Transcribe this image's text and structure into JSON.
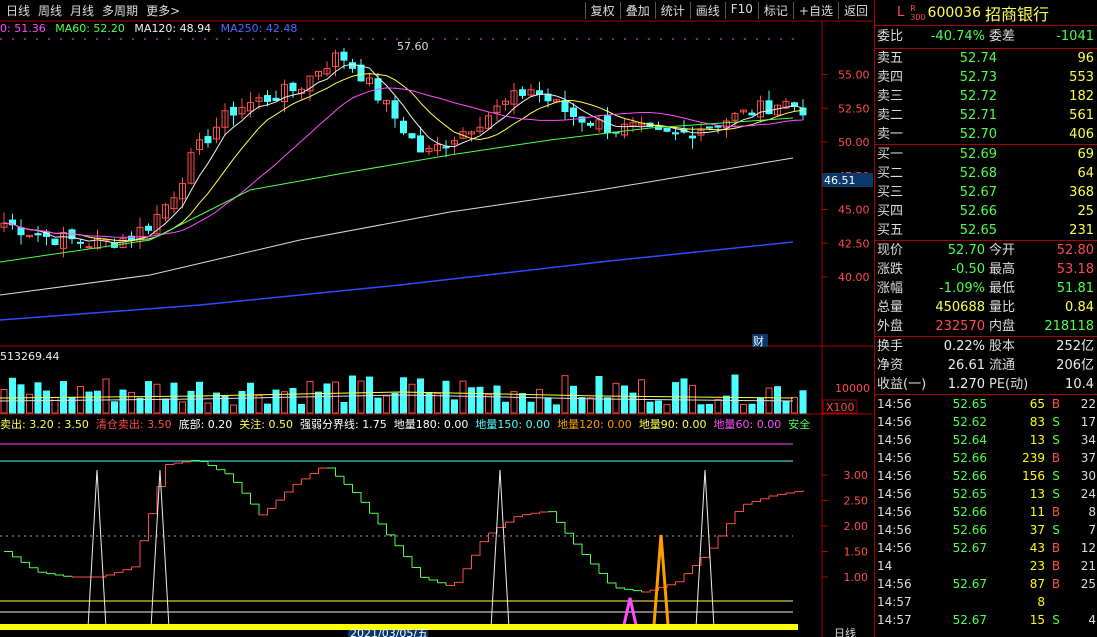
{
  "toolbar": {
    "tabs": [
      "日线",
      "周线",
      "月线",
      "多周期",
      "更多>"
    ],
    "buttons": [
      "复权",
      "叠加",
      "统计",
      "画线",
      "F10",
      "标记",
      "+自选",
      "返回"
    ]
  },
  "ma_legend": [
    {
      "text": "0: 51.36",
      "color": "#ff4cff"
    },
    {
      "text": "MA60: 52.20",
      "color": "#4cff4c"
    },
    {
      "text": "MA120: 48.94",
      "color": "#eeeeee"
    },
    {
      "text": "MA250: 42.48",
      "color": "#4c6cff"
    }
  ],
  "price_axis": [
    "55.00",
    "52.50",
    "50.00",
    "47.50",
    "45.00",
    "42.50",
    "40.00"
  ],
  "current_price_tag": "46.51",
  "high_marker": "57.60",
  "cai_label": "财",
  "volume": {
    "legend": "513269.44",
    "axis": "10000",
    "unit": "X100"
  },
  "indicator": {
    "items": [
      {
        "text": "卖出: 3.20 : 3.50",
        "color": "#ffff4c"
      },
      {
        "text": "清仓卖出: 3.50",
        "color": "#ff4c4c"
      },
      {
        "text": "底部: 0.20",
        "color": "#ffffff"
      },
      {
        "text": "关注: 0.50",
        "color": "#ffff4c"
      },
      {
        "text": "强弱分界线: 1.75",
        "color": "#ffffff"
      },
      {
        "text": "地量180: 0.00",
        "color": "#ffffff"
      },
      {
        "text": "地量150: 0.00",
        "color": "#4cffff"
      },
      {
        "text": "地量120: 0.00",
        "color": "#ff9c00"
      },
      {
        "text": "地量90: 0.00",
        "color": "#ffff4c"
      },
      {
        "text": "地量60: 0.00",
        "color": "#ff4cff"
      },
      {
        "text": "安全",
        "color": "#4cff4c"
      }
    ],
    "axis": [
      "3.00",
      "2.50",
      "2.00",
      "1.50",
      "1.00"
    ]
  },
  "date_label": "2021/03/05/五",
  "period_label": "日线",
  "quote": {
    "market_tag": "L",
    "r_tag": "R",
    "code_sub": "300",
    "code": "600036",
    "name": "招商银行",
    "weibi": {
      "label": "委比",
      "value": "-40.74%"
    },
    "weicha": {
      "label": "委差",
      "value": "-1041"
    },
    "sells": [
      {
        "label": "卖五",
        "price": "52.74",
        "qty": "96"
      },
      {
        "label": "卖四",
        "price": "52.73",
        "qty": "553"
      },
      {
        "label": "卖三",
        "price": "52.72",
        "qty": "182"
      },
      {
        "label": "卖二",
        "price": "52.71",
        "qty": "561"
      },
      {
        "label": "卖一",
        "price": "52.70",
        "qty": "406"
      }
    ],
    "buys": [
      {
        "label": "买一",
        "price": "52.69",
        "qty": "69"
      },
      {
        "label": "买二",
        "price": "52.68",
        "qty": "64"
      },
      {
        "label": "买三",
        "price": "52.67",
        "qty": "368"
      },
      {
        "label": "买四",
        "price": "52.66",
        "qty": "25"
      },
      {
        "label": "买五",
        "price": "52.65",
        "qty": "231"
      }
    ],
    "stats": [
      [
        "现价",
        "52.70",
        "g",
        "今开",
        "52.80",
        "r"
      ],
      [
        "涨跌",
        "-0.50",
        "g",
        "最高",
        "53.18",
        "r"
      ],
      [
        "涨幅",
        "-1.09%",
        "g",
        "最低",
        "51.81",
        "g"
      ],
      [
        "总量",
        "450688",
        "y",
        "量比",
        "0.84",
        "y"
      ],
      [
        "外盘",
        "232570",
        "r",
        "内盘",
        "218118",
        "g"
      ]
    ],
    "stats2": [
      [
        "换手",
        "0.22%",
        "w",
        "股本",
        "252亿",
        "w"
      ],
      [
        "净资",
        "26.61",
        "w",
        "流通",
        "206亿",
        "w"
      ],
      [
        "收益(一)",
        "1.270",
        "w",
        "PE(动)",
        "10.4",
        "w"
      ]
    ],
    "ticks": [
      [
        "14:56",
        "52.65",
        "65",
        "B",
        "22"
      ],
      [
        "14:56",
        "52.62",
        "83",
        "S",
        "17"
      ],
      [
        "14:56",
        "52.64",
        "13",
        "S",
        "34"
      ],
      [
        "14:56",
        "52.66",
        "239",
        "B",
        "37"
      ],
      [
        "14:56",
        "52.66",
        "156",
        "S",
        "30"
      ],
      [
        "14:56",
        "52.65",
        "13",
        "S",
        "24"
      ],
      [
        "14:56",
        "52.66",
        "11",
        "B",
        "8"
      ],
      [
        "14:56",
        "52.66",
        "37",
        "S",
        "7"
      ],
      [
        "14:56",
        "52.67",
        "43",
        "B",
        "12"
      ],
      [
        "14",
        "",
        "23",
        "B",
        "21"
      ],
      [
        "14:56",
        "52.67",
        "87",
        "B",
        "25"
      ],
      [
        "14:57",
        "",
        "8",
        "",
        ""
      ],
      [
        "14:57",
        "52.67",
        "15",
        "S",
        "4"
      ]
    ]
  }
}
